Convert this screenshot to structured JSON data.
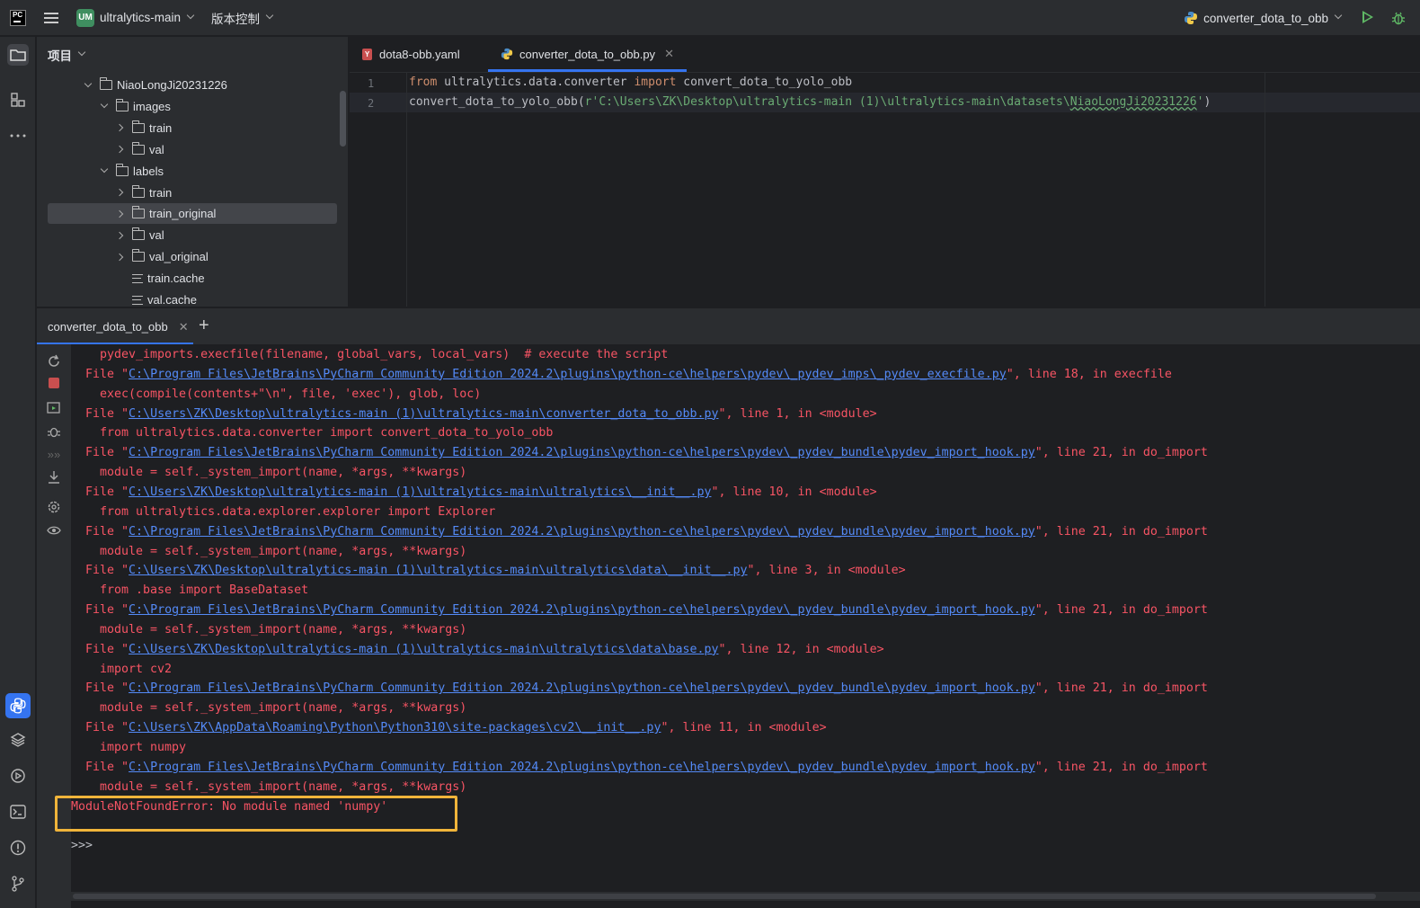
{
  "titlebar": {
    "project_badge": "UM",
    "project_name": "ultralytics-main",
    "vcs_label": "版本控制",
    "run_config": "converter_dota_to_obb"
  },
  "project_panel": {
    "title": "项目",
    "tree": [
      {
        "label": "NiaoLongJi20231226",
        "type": "folder",
        "arrow": "down"
      },
      {
        "label": "images",
        "type": "folder",
        "arrow": "down"
      },
      {
        "label": "train",
        "type": "folder",
        "arrow": "right"
      },
      {
        "label": "val",
        "type": "folder",
        "arrow": "right"
      },
      {
        "label": "labels",
        "type": "folder",
        "arrow": "down"
      },
      {
        "label": "train",
        "type": "folder",
        "arrow": "right"
      },
      {
        "label": "train_original",
        "type": "folder",
        "arrow": "right",
        "selected": true
      },
      {
        "label": "val",
        "type": "folder",
        "arrow": "right"
      },
      {
        "label": "val_original",
        "type": "folder",
        "arrow": "right"
      },
      {
        "label": "train.cache",
        "type": "file"
      },
      {
        "label": "val.cache",
        "type": "file"
      }
    ]
  },
  "editor": {
    "tabs": [
      {
        "label": "dota8-obb.yaml",
        "icon": "yaml-icon",
        "active": false
      },
      {
        "label": "converter_dota_to_obb.py",
        "icon": "python-icon",
        "active": true
      }
    ],
    "line_numbers": [
      "1",
      "2"
    ],
    "code": {
      "l1_from": "from",
      "l1_module": " ultralytics.data.converter ",
      "l1_import": "import",
      "l1_name": " convert_dota_to_yolo_obb",
      "l2_call": "convert_dota_to_yolo_obb(",
      "l2_str_a": "r'C:\\Users\\ZK\\Desktop\\ultralytics-main (1)\\ultralytics-main\\datasets\\",
      "l2_str_b": "NiaoLongJi20231226",
      "l2_str_c": "'",
      "l2_close": ")"
    }
  },
  "run_panel": {
    "tab_label": "converter_dota_to_obb",
    "prompt": ">>>",
    "lines": [
      {
        "indent": 4,
        "text": "pydev_imports.execfile(filename, global_vars, local_vars)  # execute the script"
      },
      {
        "indent": 2,
        "pre": "File \"",
        "link": "C:\\Program Files\\JetBrains\\PyCharm Community Edition 2024.2\\plugins\\python-ce\\helpers\\pydev\\_pydev_imps\\_pydev_execfile.py",
        "post": "\", line 18, in execfile"
      },
      {
        "indent": 4,
        "text": "exec(compile(contents+\"\\n\", file, 'exec'), glob, loc)"
      },
      {
        "indent": 2,
        "pre": "File \"",
        "link": "C:\\Users\\ZK\\Desktop\\ultralytics-main (1)\\ultralytics-main\\converter_dota_to_obb.py",
        "post": "\", line 1, in <module>"
      },
      {
        "indent": 4,
        "text": "from ultralytics.data.converter import convert_dota_to_yolo_obb"
      },
      {
        "indent": 2,
        "pre": "File \"",
        "link": "C:\\Program Files\\JetBrains\\PyCharm Community Edition 2024.2\\plugins\\python-ce\\helpers\\pydev\\_pydev_bundle\\pydev_import_hook.py",
        "post": "\", line 21, in do_import"
      },
      {
        "indent": 4,
        "text": "module = self._system_import(name, *args, **kwargs)"
      },
      {
        "indent": 2,
        "pre": "File \"",
        "link": "C:\\Users\\ZK\\Desktop\\ultralytics-main (1)\\ultralytics-main\\ultralytics\\__init__.py",
        "post": "\", line 10, in <module>"
      },
      {
        "indent": 4,
        "text": "from ultralytics.data.explorer.explorer import Explorer"
      },
      {
        "indent": 2,
        "pre": "File \"",
        "link": "C:\\Program Files\\JetBrains\\PyCharm Community Edition 2024.2\\plugins\\python-ce\\helpers\\pydev\\_pydev_bundle\\pydev_import_hook.py",
        "post": "\", line 21, in do_import"
      },
      {
        "indent": 4,
        "text": "module = self._system_import(name, *args, **kwargs)"
      },
      {
        "indent": 2,
        "pre": "File \"",
        "link": "C:\\Users\\ZK\\Desktop\\ultralytics-main (1)\\ultralytics-main\\ultralytics\\data\\__init__.py",
        "post": "\", line 3, in <module>"
      },
      {
        "indent": 4,
        "text": "from .base import BaseDataset"
      },
      {
        "indent": 2,
        "pre": "File \"",
        "link": "C:\\Program Files\\JetBrains\\PyCharm Community Edition 2024.2\\plugins\\python-ce\\helpers\\pydev\\_pydev_bundle\\pydev_import_hook.py",
        "post": "\", line 21, in do_import"
      },
      {
        "indent": 4,
        "text": "module = self._system_import(name, *args, **kwargs)"
      },
      {
        "indent": 2,
        "pre": "File \"",
        "link": "C:\\Users\\ZK\\Desktop\\ultralytics-main (1)\\ultralytics-main\\ultralytics\\data\\base.py",
        "post": "\", line 12, in <module>"
      },
      {
        "indent": 4,
        "text": "import cv2"
      },
      {
        "indent": 2,
        "pre": "File \"",
        "link": "C:\\Program Files\\JetBrains\\PyCharm Community Edition 2024.2\\plugins\\python-ce\\helpers\\pydev\\_pydev_bundle\\pydev_import_hook.py",
        "post": "\", line 21, in do_import"
      },
      {
        "indent": 4,
        "text": "module = self._system_import(name, *args, **kwargs)"
      },
      {
        "indent": 2,
        "pre": "File \"",
        "link": "C:\\Users\\ZK\\AppData\\Roaming\\Python\\Python310\\site-packages\\cv2\\__init__.py",
        "post": "\", line 11, in <module>"
      },
      {
        "indent": 4,
        "text": "import numpy"
      },
      {
        "indent": 2,
        "pre": "File \"",
        "link": "C:\\Program Files\\JetBrains\\PyCharm Community Edition 2024.2\\plugins\\python-ce\\helpers\\pydev\\_pydev_bundle\\pydev_import_hook.py",
        "post": "\", line 21, in do_import"
      },
      {
        "indent": 4,
        "text": "module = self._system_import(name, *args, **kwargs)"
      },
      {
        "indent": 0,
        "text": "ModuleNotFoundError: No module named 'numpy'"
      }
    ]
  },
  "colors": {
    "error_text": "#f75464",
    "link": "#548af7",
    "highlight_box": "#f0b43a",
    "accent": "#3574f0"
  }
}
